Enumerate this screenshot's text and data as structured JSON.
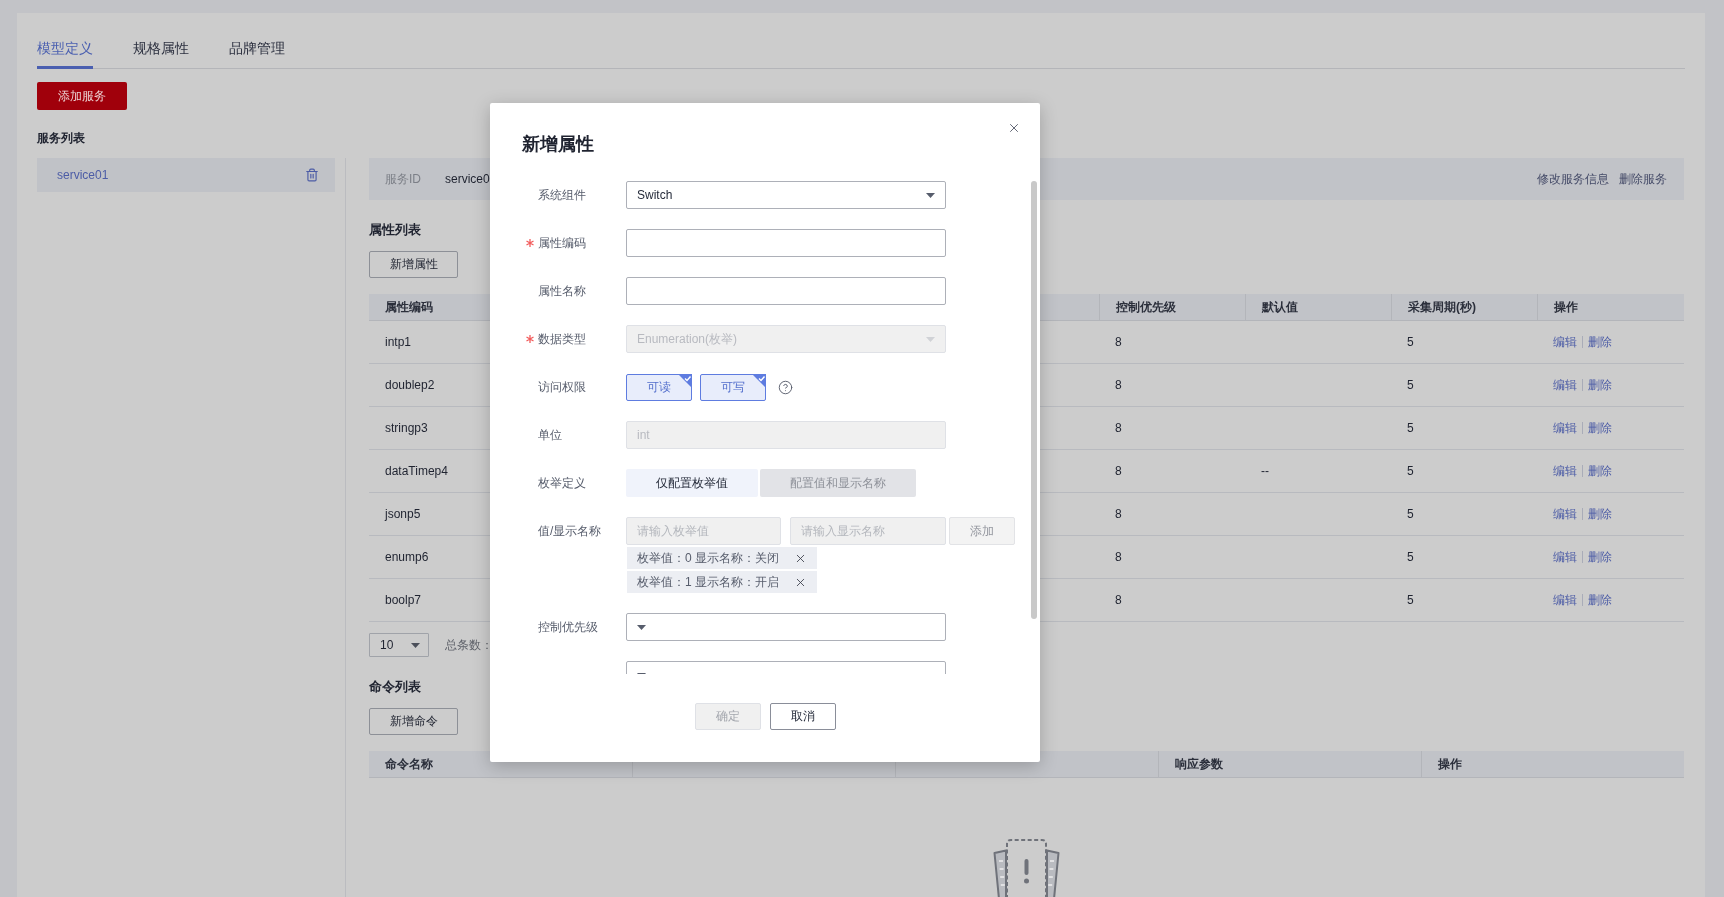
{
  "tabs": [
    {
      "label": "模型定义",
      "selected": true
    },
    {
      "label": "规格属性",
      "selected": false
    },
    {
      "label": "品牌管理",
      "selected": false
    }
  ],
  "add_service_button": "添加服务",
  "service_list": {
    "title": "服务列表",
    "items": [
      {
        "name": "service01",
        "selected": true
      }
    ]
  },
  "service_info": {
    "id_label": "服务ID",
    "id_value": "service0",
    "actions": [
      "修改服务信息",
      "删除服务"
    ]
  },
  "properties": {
    "title": "属性列表",
    "add_button": "新增属性",
    "columns": {
      "code": "属性编码",
      "priority": "控制优先级",
      "default": "默认值",
      "period": "采集周期(秒)",
      "actions": "操作"
    },
    "rows": [
      {
        "code": "intp1",
        "priority": "8",
        "period": "5",
        "actions": [
          "编辑",
          "删除"
        ]
      },
      {
        "code": "doublep2",
        "priority": "8",
        "period": "5",
        "actions": [
          "编辑",
          "删除"
        ]
      },
      {
        "code": "stringp3",
        "priority": "8",
        "period": "5",
        "actions": [
          "编辑",
          "删除"
        ]
      },
      {
        "code": "dataTimep4",
        "priority": "8",
        "default": "--",
        "period": "5",
        "actions": [
          "编辑",
          "删除"
        ]
      },
      {
        "code": "jsonp5",
        "priority": "8",
        "period": "5",
        "actions": [
          "编辑",
          "删除"
        ]
      },
      {
        "code": "enump6",
        "priority": "8",
        "period": "5",
        "actions": [
          "编辑",
          "删除"
        ]
      },
      {
        "code": "boolp7",
        "priority": "8",
        "period": "5",
        "actions": [
          "编辑",
          "删除"
        ]
      }
    ],
    "page_size": "10",
    "total_label": "总条数："
  },
  "commands": {
    "title": "命令列表",
    "add_button": "新增命令",
    "columns": {
      "name": "命令名称",
      "response": "响应参数",
      "actions": "操作"
    }
  },
  "dialog": {
    "title": "新增属性",
    "fields": [
      {
        "kind": "select",
        "label": "系统组件",
        "value": "Switch",
        "required": false,
        "disabled": false
      },
      {
        "kind": "input",
        "label": "属性编码",
        "required": true,
        "disabled": false
      },
      {
        "kind": "input",
        "label": "属性名称",
        "required": false,
        "disabled": false
      },
      {
        "kind": "select",
        "label": "数据类型",
        "value": "Enumeration(枚举)",
        "required": true,
        "disabled": true
      },
      {
        "kind": "checks",
        "label": "访问权限",
        "required": false,
        "options": [
          {
            "label": "可读",
            "checked": true
          },
          {
            "label": "可写",
            "checked": true
          }
        ]
      },
      {
        "kind": "input",
        "label": "单位",
        "value": "int",
        "required": false,
        "disabled": true
      },
      {
        "kind": "segmented",
        "label": "枚举定义",
        "required": false,
        "options": [
          {
            "label": "仅配置枚举值",
            "selected": true
          },
          {
            "label": "配置值和显示名称",
            "selected": false
          }
        ]
      },
      {
        "kind": "enum",
        "label": "值/显示名称",
        "required": false,
        "disabled": true,
        "value_placeholder": "请输入枚举值",
        "name_placeholder": "请输入显示名称",
        "add_button": "添加",
        "entries": [
          "枚举值：0 显示名称：关闭",
          "枚举值：1 显示名称：开启"
        ]
      },
      {
        "kind": "select",
        "label": "控制优先级",
        "required": false,
        "disabled": false
      },
      {
        "kind": "select",
        "disabled": false
      }
    ],
    "buttons": [
      {
        "label": "确定",
        "disabled": true
      },
      {
        "label": "取消",
        "disabled": false
      }
    ]
  }
}
